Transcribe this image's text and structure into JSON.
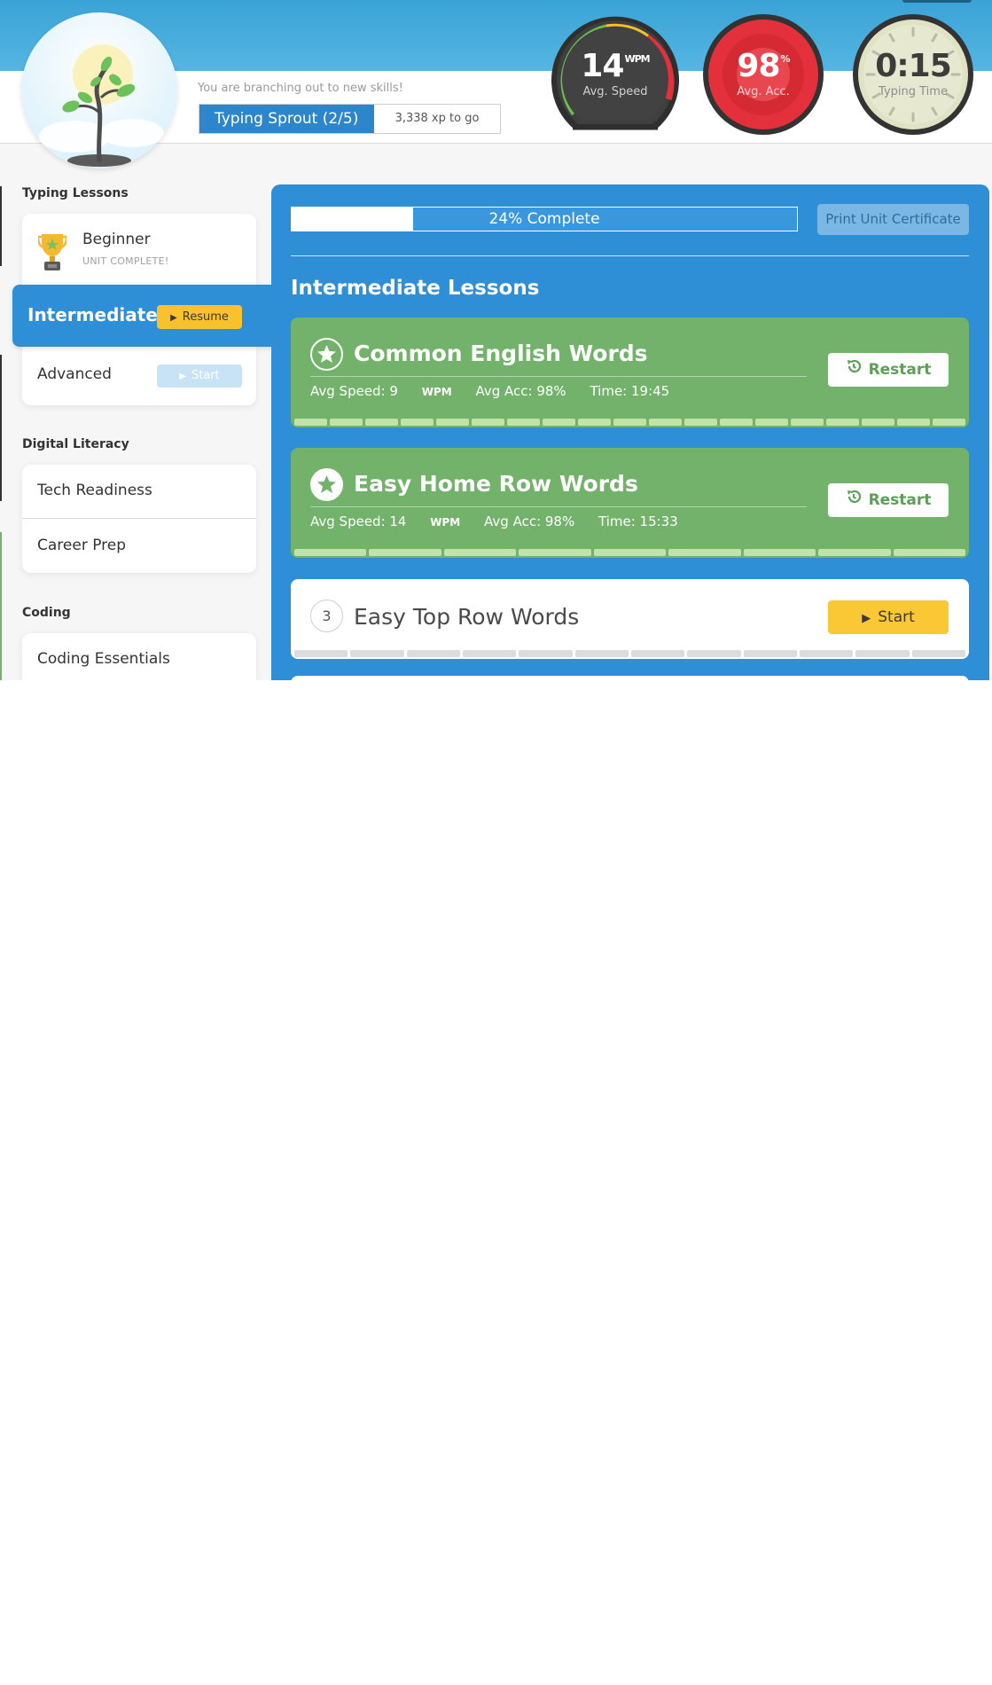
{
  "header": {
    "level_message": "You are branching out to new skills!",
    "level_name": "Typing Sprout (2/5)",
    "level_progress": 0.58,
    "xp_to_go": "3,338 xp to go"
  },
  "stats": {
    "speed": {
      "value": "14",
      "unit": "WPM",
      "label": "Avg. Speed"
    },
    "accuracy": {
      "value": "98",
      "unit": "%",
      "label": "Avg. Acc."
    },
    "time": {
      "value": "0:15",
      "label": "Typing Time"
    }
  },
  "sidebar": {
    "typing_lessons_title": "Typing Lessons",
    "beginner": {
      "label": "Beginner",
      "status": "UNIT COMPLETE!"
    },
    "intermediate": {
      "label": "Intermediate",
      "button": "Resume"
    },
    "advanced": {
      "label": "Advanced",
      "button": "Start"
    },
    "digital_literacy_title": "Digital Literacy",
    "digital_items": [
      "Tech Readiness",
      "Career Prep"
    ],
    "coding_title": "Coding",
    "coding_items": [
      "Coding Essentials"
    ]
  },
  "main": {
    "progress_text": "24% Complete",
    "progress_value": 0.24,
    "print_button": "Print Unit Certificate",
    "section_title": "Intermediate Lessons",
    "lessons": [
      {
        "title": "Common English Words",
        "speed_label": "Avg Speed: 9",
        "speed_unit": "WPM",
        "acc": "Avg Acc: 98%",
        "time": "Time: 19:45",
        "button": "Restart"
      },
      {
        "title": "Easy Home Row Words",
        "speed_label": "Avg Speed: 14",
        "speed_unit": "WPM",
        "acc": "Avg Acc: 98%",
        "time": "Time: 15:33",
        "button": "Restart"
      },
      {
        "number": "3",
        "title": "Easy Top Row Words",
        "button": "Start"
      }
    ]
  },
  "colors": {
    "header_blue": "#3aa3d6",
    "panel_blue": "#2e8fd7",
    "lesson_green": "#72b26a",
    "button_yellow": "#fbc835",
    "accuracy_red": "#e4303a"
  }
}
